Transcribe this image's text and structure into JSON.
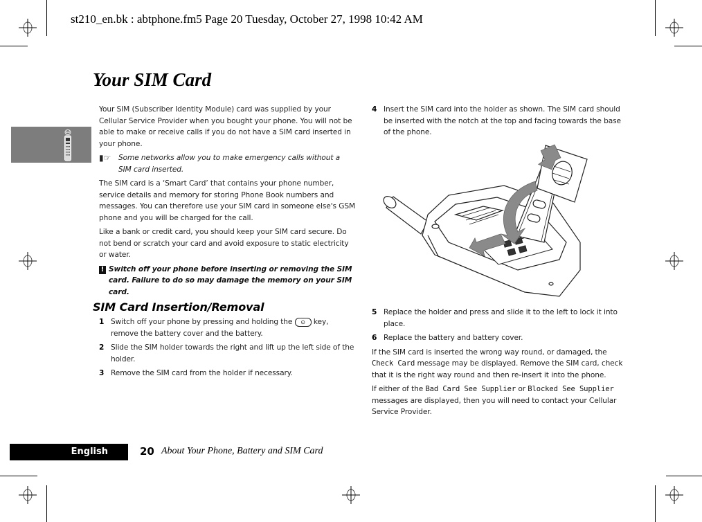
{
  "header": {
    "print_slug": "st210_en.bk : abtphone.fm5  Page 20  Tuesday, October 27, 1998  10:42 AM"
  },
  "page": {
    "title": "Your SIM Card"
  },
  "icons": {
    "phone_thumbnail": "phone-icon",
    "note": "pointing-hand-icon",
    "warning": "exclamation-icon",
    "power_key": "power-key-icon"
  },
  "left_column": {
    "intro": "Your SIM (Subscriber Identity Module) card was supplied by your Cellular Service Provider when you bought your phone. You will not be able to make or receive calls if you do not have a SIM card inserted in your phone.",
    "note": "Some networks allow you to make emergency calls without a SIM card inserted.",
    "para_smart_card": "The SIM card is a ‘Smart Card’ that contains your phone number, service details and memory for storing Phone Book numbers and messages. You can therefore use your SIM card in someone else's GSM phone and you will be charged for the call.",
    "para_secure": "Like a bank or credit card, you should keep your SIM card secure. Do not bend or scratch your card and avoid exposure to static electricity or water.",
    "warning": "Switch off your phone before inserting or removing the SIM card. Failure to do so may damage the memory on your SIM card.",
    "subheading": "SIM Card Insertion/Removal",
    "steps": [
      {
        "num": "1",
        "text_before": "Switch off your phone by pressing and holding the",
        "key_glyph": "⊙",
        "text_after": "key, remove the battery cover and the battery."
      },
      {
        "num": "2",
        "text": "Slide the SIM holder towards the right and lift up the left side of the holder."
      },
      {
        "num": "3",
        "text": "Remove the SIM card from the holder if necessary."
      }
    ]
  },
  "right_column": {
    "steps": [
      {
        "num": "4",
        "text": "Insert the SIM card into the holder as shown. The SIM card should be inserted with the notch at the top and facing towards the base of the phone."
      },
      {
        "num": "5",
        "text": "Replace the holder and press and slide it to the left to lock it into place."
      },
      {
        "num": "6",
        "text": "Replace the battery and battery cover."
      }
    ],
    "para_check": {
      "before": "If the SIM card is inserted the wrong way round, or damaged, the",
      "message": "Check Card",
      "after": "message may be displayed. Remove the SIM card, check that it is the right way round and then re-insert it into the phone."
    },
    "para_supplier": {
      "before": "If either of the",
      "message1": "Bad Card See Supplier",
      "middle": "or",
      "message2": "Blocked See Supplier",
      "after": "messages are displayed, then you will need to contact your Cellular Service Provider."
    },
    "illustration": "sim-card-insertion-illustration"
  },
  "footer": {
    "language": "English",
    "page_number": "20",
    "chapter_title": "About Your Phone, Battery and SIM Card"
  }
}
